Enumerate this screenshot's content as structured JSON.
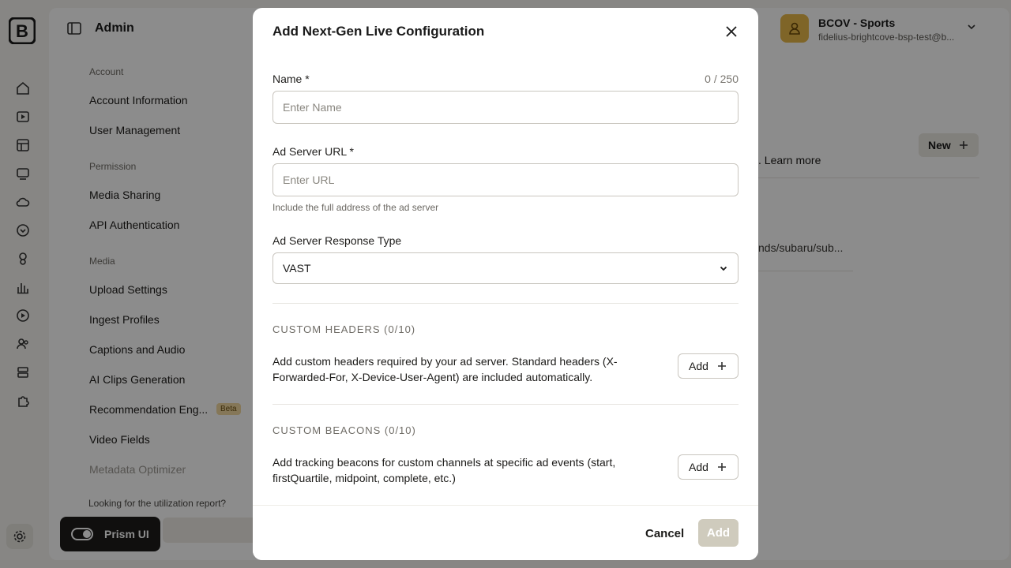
{
  "app": {
    "title": "Admin",
    "account": {
      "name": "BCOV - Sports",
      "email": "fidelius-brightcove-bsp-test@b..."
    },
    "sidebar": {
      "sections": [
        {
          "label": "Account",
          "items": [
            "Account Information",
            "User Management"
          ]
        },
        {
          "label": "Permission",
          "items": [
            "Media Sharing",
            "API Authentication"
          ]
        },
        {
          "label": "Media",
          "items": [
            "Upload Settings",
            "Ingest Profiles",
            "Captions and Audio",
            "AI Clips Generation",
            "Recommendation Eng...",
            "Video Fields",
            "Metadata Optimizer"
          ]
        }
      ],
      "beta_badge": "Beta",
      "utilization_link": "Looking for the utilization report?"
    },
    "prism_toggle": "Prism UI",
    "new_button": "New",
    "learn_more": ". Learn more",
    "path_fragment": "nds/subaru/sub..."
  },
  "modal": {
    "title": "Add Next-Gen Live Configuration",
    "name": {
      "label": "Name *",
      "counter": "0 / 250",
      "placeholder": "Enter Name",
      "value": ""
    },
    "ad_server_url": {
      "label": "Ad Server URL *",
      "placeholder": "Enter URL",
      "value": "",
      "help": "Include the full address of the ad server"
    },
    "response_type": {
      "label": "Ad Server Response Type",
      "selected": "VAST"
    },
    "custom_headers": {
      "title": "CUSTOM HEADERS (0/10)",
      "description": "Add custom headers required by your ad server. Standard headers (X-Forwarded-For, X-Device-User-Agent) are included automatically.",
      "add_label": "Add"
    },
    "custom_beacons": {
      "title": "CUSTOM BEACONS (0/10)",
      "description": "Add tracking beacons for custom channels at specific ad events (start, firstQuartile, midpoint, complete, etc.)",
      "add_label": "Add"
    },
    "footer": {
      "cancel": "Cancel",
      "submit": "Add"
    }
  },
  "colors": {
    "overlay": "#00000073",
    "primary_disabled": "#cfcbbd",
    "avatar": "#e8b84a"
  }
}
